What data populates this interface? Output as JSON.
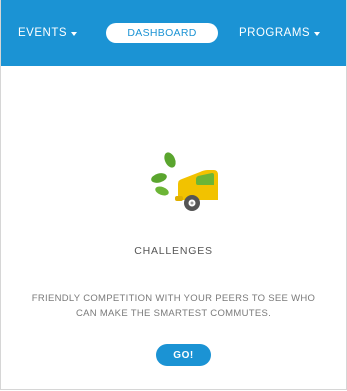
{
  "nav": {
    "events_label": "EVENTS",
    "dashboard_label": "DASHBOARD",
    "programs_label": "PROGRAMS"
  },
  "card": {
    "icon": "leaf-car-icon",
    "title": "CHALLENGES",
    "description": "FRIENDLY COMPETITION WITH YOUR PEERS TO SEE WHO CAN MAKE THE SMARTEST COMMUTES.",
    "go_label": "GO!"
  },
  "colors": {
    "brand_blue": "#1b93d4",
    "leaf_green": "#5aa52e",
    "car_yellow": "#f2c200"
  }
}
